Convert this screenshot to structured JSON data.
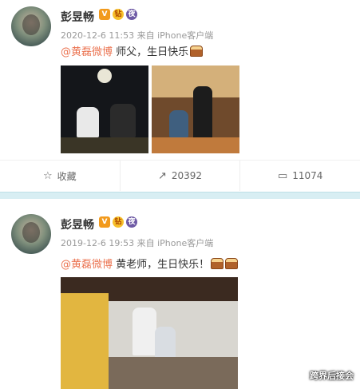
{
  "posts": [
    {
      "name": "彭昱畅",
      "badges": {
        "v": "V",
        "m": "钻",
        "c": "夜"
      },
      "meta": "2020-12-6 11:53 来自 iPhone客户端",
      "mention": "@黄磊微博",
      "text": " 师父，生日快乐",
      "actions": [
        {
          "icon": "☆",
          "label": "收藏"
        },
        {
          "icon": "↗",
          "label": "20392"
        },
        {
          "icon": "▭",
          "label": "11074"
        }
      ]
    },
    {
      "name": "彭昱畅",
      "badges": {
        "v": "V",
        "m": "钻",
        "c": "夜"
      },
      "meta": "2019-12-6 19:53 来自 iPhone客户端",
      "mention": "@黄磊微博",
      "text": " 黄老师，生日快乐！"
    }
  ],
  "watermark": "跨界后接会"
}
